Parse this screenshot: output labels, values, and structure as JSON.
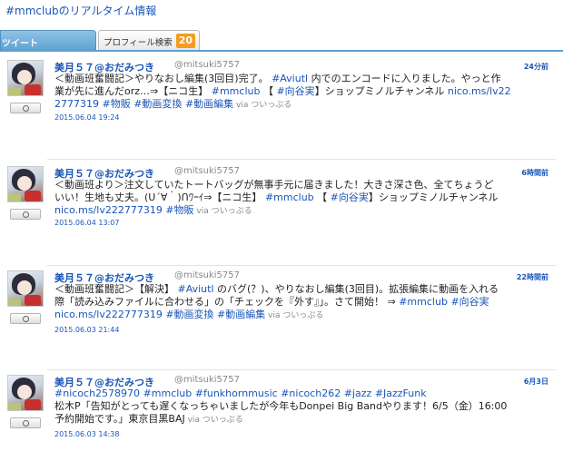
{
  "header": {
    "title": "#mmclubのリアルタイム情報"
  },
  "tabs": {
    "tweets_label": "ツイート",
    "profile_label": "プロフィール検索",
    "profile_count": "20"
  },
  "tweets": [
    {
      "name": "美月５７@おだみつき",
      "handle": "@mitsuki5757",
      "time": "24分前",
      "lines": [
        [
          {
            "t": "＜動画班奮闘記＞やりなおし編集(3回目)完了。 ",
            "l": false
          },
          {
            "t": "#Aviutl",
            "l": true
          },
          {
            "t": " 内でのエンコードに入りました。やっと作",
            "l": false
          }
        ],
        [
          {
            "t": "業が先に進んだorz…⇒【ニコ生】 ",
            "l": false
          },
          {
            "t": "#mmclub",
            "l": true
          },
          {
            "t": " 【 ",
            "l": false
          },
          {
            "t": "#向谷実",
            "l": true
          },
          {
            "t": "】ショップミノルチャンネル ",
            "l": false
          },
          {
            "t": "nico.ms/lv22",
            "l": true
          }
        ],
        [
          {
            "t": "2777319",
            "l": true
          },
          {
            "t": " ",
            "l": false
          },
          {
            "t": "#物販",
            "l": true
          },
          {
            "t": " ",
            "l": false
          },
          {
            "t": "#動画変換",
            "l": true
          },
          {
            "t": " ",
            "l": false
          },
          {
            "t": "#動画編集",
            "l": true
          }
        ]
      ],
      "via_label": "via",
      "client": "ついっぷる",
      "date": "2015.06.04 19:24"
    },
    {
      "name": "美月５７@おだみつき",
      "handle": "@mitsuki5757",
      "time": "6時間前",
      "lines": [
        [
          {
            "t": "＜動画班より＞注文していたトートバッグが無事手元に届きました！大きさ深さ色、全てちょうど",
            "l": false
          }
        ],
        [
          {
            "t": "いい！生地も丈夫。(ᑌ´∀｀)ᑎﾜｰｲ⇒【ニコ生】 ",
            "l": false
          },
          {
            "t": "#mmclub",
            "l": true
          },
          {
            "t": " 【 ",
            "l": false
          },
          {
            "t": "#向谷実",
            "l": true
          },
          {
            "t": "】ショップミノルチャンネル",
            "l": false
          }
        ],
        [
          {
            "t": "nico.ms/lv222777319",
            "l": true
          },
          {
            "t": " ",
            "l": false
          },
          {
            "t": "#物販",
            "l": true
          }
        ]
      ],
      "via_label": "via",
      "client": "ついっぷる",
      "date": "2015.06.04 13:07"
    },
    {
      "name": "美月５７@おだみつき",
      "handle": "@mitsuki5757",
      "time": "22時間前",
      "lines": [
        [
          {
            "t": "＜動画班奮闘記＞【解決】 ",
            "l": false
          },
          {
            "t": "#Aviutl",
            "l": true
          },
          {
            "t": " のバグ(？)、やりなおし編集(3回目)。拡張編集に動画を入れる",
            "l": false
          }
        ],
        [
          {
            "t": "際「読み込みファイルに合わせる」の「チェックを『外す』」。さて開始！ ⇒ ",
            "l": false
          },
          {
            "t": "#mmclub",
            "l": true
          },
          {
            "t": " ",
            "l": false
          },
          {
            "t": "#向谷実",
            "l": true
          }
        ],
        [
          {
            "t": "nico.ms/lv222777319",
            "l": true
          },
          {
            "t": " ",
            "l": false
          },
          {
            "t": "#動画変換",
            "l": true
          },
          {
            "t": " ",
            "l": false
          },
          {
            "t": "#動画編集",
            "l": true
          }
        ]
      ],
      "via_label": "via",
      "client": "ついっぷる",
      "date": "2015.06.03 21:44"
    },
    {
      "name": "美月５７@おだみつき",
      "handle": "@mitsuki5757",
      "time": "6月3日",
      "lines": [
        [
          {
            "t": "#nicoch2578970",
            "l": true
          },
          {
            "t": " ",
            "l": false
          },
          {
            "t": "#mmclub",
            "l": true
          },
          {
            "t": " ",
            "l": false
          },
          {
            "t": "#funkhornmusic",
            "l": true
          },
          {
            "t": " ",
            "l": false
          },
          {
            "t": "#nicoch262",
            "l": true
          },
          {
            "t": " ",
            "l": false
          },
          {
            "t": "#jazz",
            "l": true
          },
          {
            "t": " ",
            "l": false
          },
          {
            "t": "#JazzFunk",
            "l": true
          }
        ],
        [
          {
            "t": "松木P「告知がとっても遅くなっちゃいましたが今年もDonpei Big Bandやります！6/5（金）16:00",
            "l": false
          }
        ],
        [
          {
            "t": "予約開始です。」東京目黒BAJ",
            "l": false
          }
        ]
      ],
      "via_label": "via",
      "client": "ついっぷる",
      "date": "2015.06.03 14:38"
    }
  ]
}
